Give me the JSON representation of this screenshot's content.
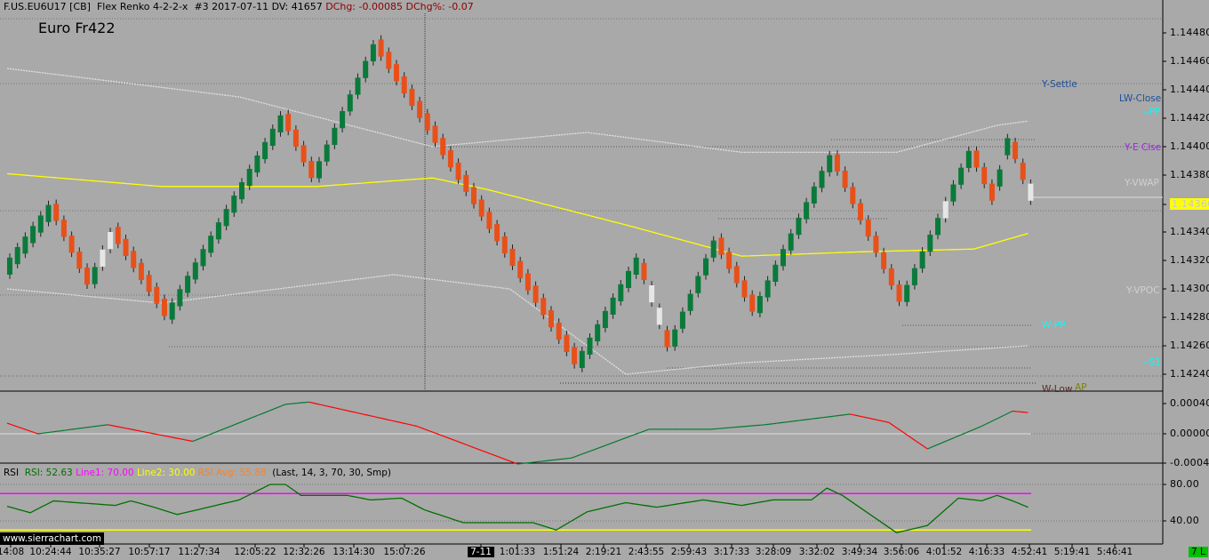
{
  "header": {
    "symbol": "F.US.EU6U17 [CB]",
    "chart_type": "Flex Renko 4-2-2-x",
    "chart_num": "#3",
    "date": "2017-07-11",
    "dv": "DV: 41657",
    "dchg": "DChg: -0.00085",
    "dchg_pct": "DChg%: -0.07"
  },
  "title": "Euro Fr422",
  "level_labels": [
    {
      "text": "Y-Settle",
      "color": "#1e4f96"
    },
    {
      "text": "LW-Close",
      "color": "#1e4f96"
    },
    {
      "text": "--PP",
      "color": "#00ffff"
    },
    {
      "text": "Y-E Clse",
      "color": "#a020f0"
    },
    {
      "text": "Y-VWAP",
      "color": "#d0d0d0"
    },
    {
      "text": "Y-VPOC",
      "color": "#d0d0d0"
    },
    {
      "text": "W-PP",
      "color": "#00ffff"
    },
    {
      "text": "--S1",
      "color": "#00ffff"
    },
    {
      "text": "W-Low",
      "color": "#5a2a2a"
    },
    {
      "text": "AP",
      "color": "#808000"
    }
  ],
  "price_axis": [
    "1.14480",
    "1.14460",
    "1.14440",
    "1.14420",
    "1.14400",
    "1.14380",
    "1.14340",
    "1.14320",
    "1.14300",
    "1.14280",
    "1.14260",
    "1.14240"
  ],
  "current_price": "1.14360",
  "osc_axis": [
    "0.00040",
    "0.00000",
    "-0.00040"
  ],
  "rsi_axis": [
    "80.00",
    "40.00"
  ],
  "rsi_legend": {
    "name": "RSI",
    "rsi": "RSI: 52.63",
    "line1": "Line1: 70.00",
    "line2": "Line2: 30.00",
    "avg": "RSI Avg: 55.88",
    "params": "(Last, 14, 3, 70, 30, Smp)"
  },
  "watermark": "www.sierrachart.com",
  "time_axis": [
    "14:08",
    "10:24:44",
    "10:35:27",
    "10:57:17",
    "11:27:34",
    "12:05:22",
    "12:32:26",
    "13:14:30",
    "15:07:26",
    "7-11",
    "1:01:33",
    "1:51:24",
    "2:19:21",
    "2:43:55",
    "2:59:43",
    "3:17:33",
    "3:28:09",
    "3:32:02",
    "3:49:34",
    "3:56:06",
    "4:01:52",
    "4:16:33",
    "4:52:41",
    "5:19:41",
    "5:46:41"
  ],
  "bars_badge": "7 L",
  "colors": {
    "up": "#0a7a3a",
    "down": "#e8501a",
    "ma": "#ffff00",
    "band": "#e0e0e0",
    "rsi": "#007000",
    "line1": "#ff00ff",
    "line2": "#ffff00"
  },
  "chart_data": {
    "type": "candlestick-renko",
    "brick": 0.00012,
    "price_pivots": [
      [
        0,
        1.14322
      ],
      [
        5,
        1.14359
      ],
      [
        10,
        1.14303
      ],
      [
        13,
        1.1434
      ],
      [
        20,
        1.14281
      ],
      [
        35,
        1.14422
      ],
      [
        39,
        1.14378
      ],
      [
        47,
        1.14472
      ],
      [
        73,
        1.14247
      ],
      [
        81,
        1.14322
      ],
      [
        85,
        1.14259
      ],
      [
        91,
        1.14334
      ],
      [
        96,
        1.14284
      ],
      [
        106,
        1.14394
      ],
      [
        115,
        1.14291
      ],
      [
        124,
        1.14397
      ],
      [
        127,
        1.14362
      ],
      [
        129,
        1.14406
      ],
      [
        132,
        1.14362
      ]
    ],
    "ma": [
      [
        0,
        1.14381
      ],
      [
        20,
        1.14372
      ],
      [
        40,
        1.14372
      ],
      [
        55,
        1.14378
      ],
      [
        62,
        1.1437
      ],
      [
        80,
        1.14345
      ],
      [
        95,
        1.14323
      ],
      [
        110,
        1.14326
      ],
      [
        125,
        1.14328
      ],
      [
        132,
        1.14339
      ]
    ],
    "upper_band": [
      [
        0,
        1.14455
      ],
      [
        30,
        1.14435
      ],
      [
        55,
        1.144
      ],
      [
        75,
        1.1441
      ],
      [
        95,
        1.14396
      ],
      [
        115,
        1.14396
      ],
      [
        128,
        1.14415
      ],
      [
        132,
        1.14418
      ]
    ],
    "lower_band": [
      [
        0,
        1.143
      ],
      [
        20,
        1.1429
      ],
      [
        50,
        1.1431
      ],
      [
        65,
        1.143
      ],
      [
        80,
        1.1424
      ],
      [
        95,
        1.14248
      ],
      [
        115,
        1.14254
      ],
      [
        132,
        1.1426
      ]
    ],
    "oscillator": [
      [
        0,
        0.00014
      ],
      [
        4,
        0
      ],
      [
        13,
        0.00012
      ],
      [
        24,
        -0.0001
      ],
      [
        36,
        0.00039
      ],
      [
        39,
        0.00042
      ],
      [
        53,
        0.0001
      ],
      [
        66,
        -0.0004
      ],
      [
        73,
        -0.00032
      ],
      [
        83,
        6e-05
      ],
      [
        91,
        6e-05
      ],
      [
        98,
        0.00012
      ],
      [
        109,
        0.00026
      ],
      [
        114,
        0.00015
      ],
      [
        119,
        -0.0002
      ],
      [
        126,
        0.0001
      ],
      [
        130,
        0.0003
      ],
      [
        132,
        0.00028
      ]
    ],
    "rsi": [
      [
        0,
        56
      ],
      [
        3,
        49
      ],
      [
        6,
        62
      ],
      [
        9,
        60
      ],
      [
        14,
        57
      ],
      [
        16,
        62
      ],
      [
        19,
        55
      ],
      [
        22,
        47
      ],
      [
        27,
        57
      ],
      [
        30,
        63
      ],
      [
        34,
        80
      ],
      [
        36,
        80
      ],
      [
        38,
        68
      ],
      [
        44,
        68
      ],
      [
        47,
        63
      ],
      [
        51,
        65
      ],
      [
        54,
        52
      ],
      [
        59,
        38
      ],
      [
        68,
        38
      ],
      [
        71,
        30
      ],
      [
        75,
        50
      ],
      [
        80,
        60
      ],
      [
        84,
        55
      ],
      [
        90,
        63
      ],
      [
        95,
        57
      ],
      [
        99,
        63
      ],
      [
        104,
        63
      ],
      [
        106,
        76
      ],
      [
        108,
        68
      ],
      [
        115,
        27
      ],
      [
        119,
        35
      ],
      [
        123,
        65
      ],
      [
        126,
        62
      ],
      [
        128,
        68
      ],
      [
        130,
        62
      ],
      [
        132,
        55
      ]
    ],
    "rsi_line1": 70,
    "rsi_line2": 30
  }
}
